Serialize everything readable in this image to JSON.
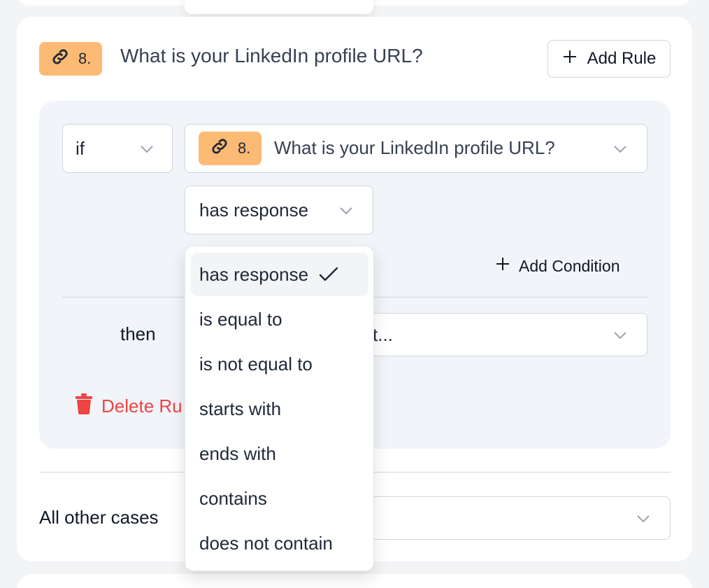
{
  "question": {
    "badge_number": "8.",
    "title": "What is your LinkedIn profile URL?"
  },
  "buttons": {
    "add_rule": "Add Rule",
    "add_condition": "Add Condition",
    "delete_rule": "Delete Ru"
  },
  "rule": {
    "if_label": "if",
    "condition_question_number": "8.",
    "condition_question_title": "What is your LinkedIn profile URL?",
    "operator_value": "has response",
    "then_label": "then",
    "then_select_value": "t..."
  },
  "other_cases": {
    "label": "All other cases"
  },
  "operator_menu": {
    "items": [
      "has response",
      "is equal to",
      "is not equal to",
      "starts with",
      "ends with",
      "contains",
      "does not contain"
    ],
    "selected_index": 0
  },
  "colors": {
    "badge": "#fdba74",
    "delete": "#ef4444",
    "panel": "#f1f4f8"
  }
}
